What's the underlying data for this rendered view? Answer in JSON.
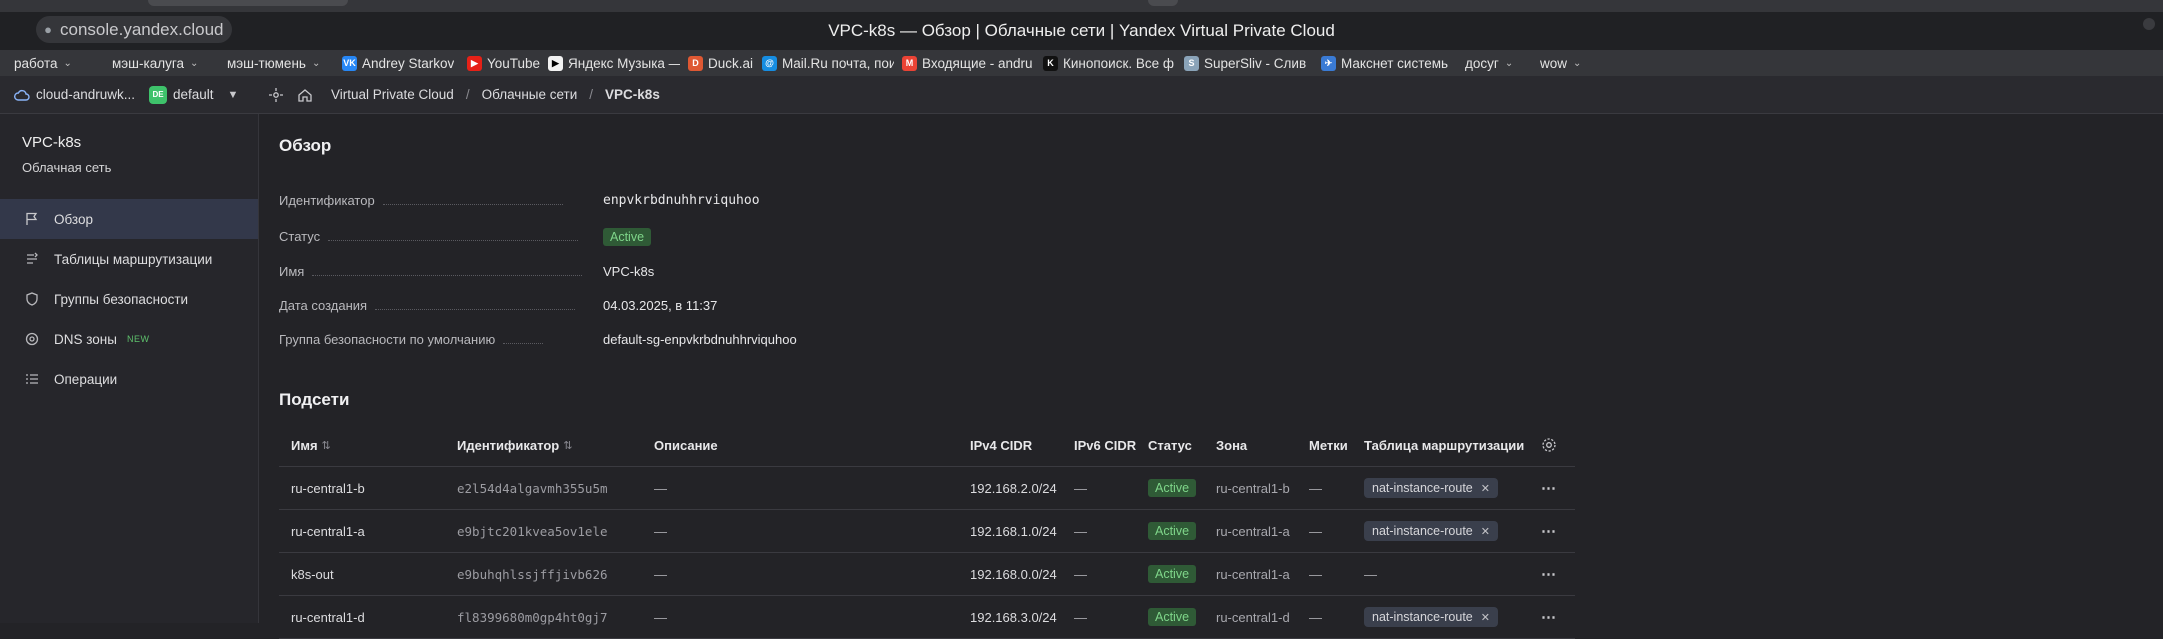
{
  "browser": {
    "url": "console.yandex.cloud",
    "window_title": "VPC-k8s — Обзор | Облачные сети | Yandex Virtual Private Cloud"
  },
  "bookmarks": [
    {
      "label": "работа",
      "folder": true,
      "icon": "folder-icon"
    },
    {
      "label": "мэш-калуга",
      "folder": true,
      "icon": "folder-icon"
    },
    {
      "label": "мэш-тюмень",
      "folder": true,
      "icon": "folder-icon"
    },
    {
      "label": "Andrey Starkov",
      "icon": "vk-icon",
      "icon_color": "#2787f5",
      "glyph": "VK"
    },
    {
      "label": "YouTube",
      "icon": "youtube-icon",
      "icon_color": "#e62117",
      "glyph": "▶"
    },
    {
      "label": "Яндекс Музыка —",
      "icon": "yandex-music-icon",
      "icon_color": "#f2f2f2",
      "glyph": "▶"
    },
    {
      "label": "Duck.ai",
      "icon": "duckduckgo-icon",
      "icon_color": "#de5833",
      "glyph": "D"
    },
    {
      "label": "Mail.Ru почта, пои",
      "icon": "mailru-icon",
      "icon_color": "#168de2",
      "glyph": "@"
    },
    {
      "label": "Входящие - andru",
      "icon": "gmail-icon",
      "icon_color": "#ea4335",
      "glyph": "M"
    },
    {
      "label": "Кинопоиск. Все ф",
      "icon": "kinopoisk-icon",
      "icon_color": "#111111",
      "glyph": "K"
    },
    {
      "label": "SuperSliv - Слив",
      "icon": "supersliv-icon",
      "icon_color": "#8aa3b8",
      "glyph": "S"
    },
    {
      "label": "Макснет системь",
      "icon": "maksnet-icon",
      "icon_color": "#3a7bd5",
      "glyph": "✈"
    },
    {
      "label": "досуг",
      "folder": true,
      "icon": "folder-icon"
    },
    {
      "label": "wow",
      "folder": true,
      "icon": "folder-icon"
    }
  ],
  "header": {
    "cloud": "cloud-andruwk...",
    "folder_badge": "DE",
    "folder": "default",
    "breadcrumbs": [
      "Virtual Private Cloud",
      "Облачные сети",
      "VPC-k8s"
    ]
  },
  "sidebar": {
    "title": "VPC-k8s",
    "subtitle": "Облачная сеть",
    "items": [
      {
        "label": "Обзор",
        "icon": "flag-icon",
        "active": true
      },
      {
        "label": "Таблицы маршрутизации",
        "icon": "route-table-icon"
      },
      {
        "label": "Группы безопасности",
        "icon": "shield-icon"
      },
      {
        "label": "DNS зоны",
        "icon": "dns-icon",
        "badge": "NEW"
      },
      {
        "label": "Операции",
        "icon": "operations-list-icon"
      }
    ]
  },
  "overview": {
    "title": "Обзор",
    "props": [
      {
        "label": "Идентификатор",
        "value": "enpvkrbdnuhhrviquhoo",
        "kind": "mono"
      },
      {
        "label": "Статус",
        "value": "Active",
        "kind": "badge"
      },
      {
        "label": "Имя",
        "value": "VPC-k8s",
        "kind": "text"
      },
      {
        "label": "Дата создания",
        "value": "04.03.2025, в 11:37",
        "kind": "text"
      },
      {
        "label": "Группа безопасности по умолчанию",
        "value": "default-sg-enpvkrbdnuhhrviquhoo",
        "kind": "link"
      }
    ]
  },
  "subnets": {
    "title": "Подсети",
    "columns": [
      "Имя",
      "Идентификатор",
      "Описание",
      "IPv4 CIDR",
      "IPv6 CIDR",
      "Статус",
      "Зона",
      "Метки",
      "Таблица маршрутизации"
    ],
    "rows": [
      {
        "name": "ru-central1-b",
        "id": "e2l54d4algavmh355u5m",
        "description": "—",
        "ipv4": "192.168.2.0/24",
        "ipv6": "—",
        "status": "Active",
        "zone": "ru-central1-b",
        "labels": "—",
        "route_table": "nat-instance-route"
      },
      {
        "name": "ru-central1-a",
        "id": "e9bjtc201kvea5ov1ele",
        "description": "—",
        "ipv4": "192.168.1.0/24",
        "ipv6": "—",
        "status": "Active",
        "zone": "ru-central1-a",
        "labels": "—",
        "route_table": "nat-instance-route"
      },
      {
        "name": "k8s-out",
        "id": "e9buhqhlssjffjivb626",
        "description": "—",
        "ipv4": "192.168.0.0/24",
        "ipv6": "—",
        "status": "Active",
        "zone": "ru-central1-a",
        "labels": "—",
        "route_table": "—"
      },
      {
        "name": "ru-central1-d",
        "id": "fl8399680m0gp4ht0gj7",
        "description": "—",
        "ipv4": "192.168.3.0/24",
        "ipv6": "—",
        "status": "Active",
        "zone": "ru-central1-d",
        "labels": "—",
        "route_table": "nat-instance-route"
      }
    ],
    "more_icon": "⋯"
  }
}
